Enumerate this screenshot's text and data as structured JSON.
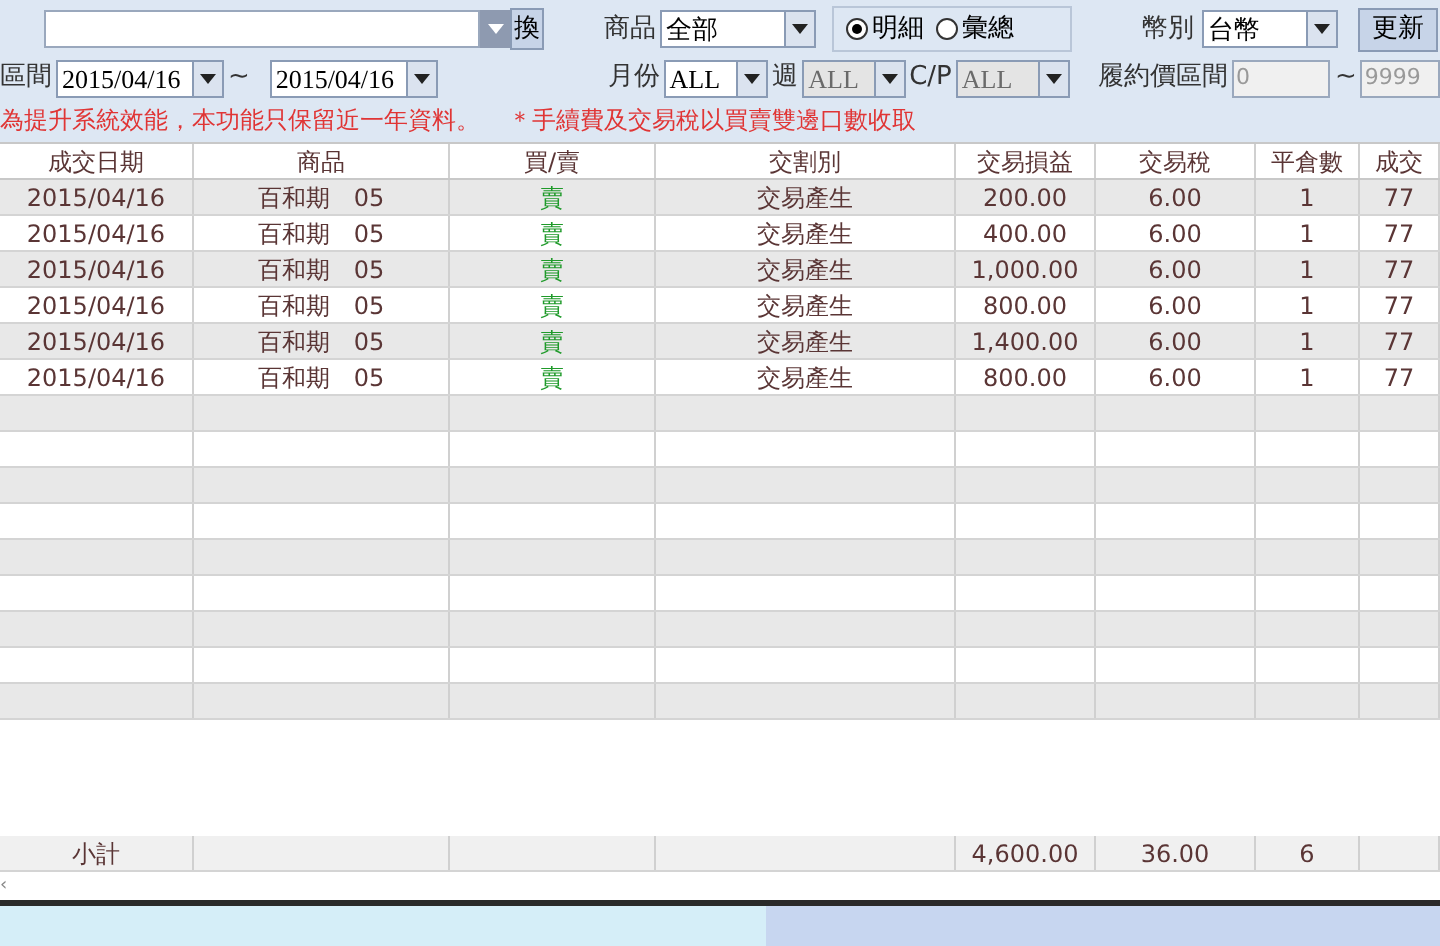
{
  "filters": {
    "account_button": "換",
    "product_label": "商品",
    "product_value": "全部",
    "view_options": [
      {
        "label": "明細",
        "selected": true
      },
      {
        "label": "彙總",
        "selected": false
      }
    ],
    "currency_label": "幣別",
    "currency_value": "台幣",
    "refresh_button": "更新",
    "date_label": "區間",
    "date_from": "2015/04/16",
    "date_sep": "~",
    "date_to": "2015/04/16",
    "month_label": "月份",
    "month_value": "ALL",
    "week_label": "週",
    "week_value": "ALL",
    "week_disabled": true,
    "cp_label": "C/P",
    "cp_value": "ALL",
    "cp_disabled": true,
    "strike_label": "履約價區間",
    "strike_from": "0",
    "strike_sep": "~",
    "strike_to": "9999",
    "strike_disabled": true
  },
  "notes": [
    "為提升系統效能，本功能只保留近一年資料。",
    "＊手續費及交易稅以買賣雙邊口數收取"
  ],
  "table": {
    "columns": [
      "成交日期",
      "商品",
      "買/賣",
      "交割別",
      "交易損益",
      "交易稅",
      "平倉數",
      "成交"
    ],
    "rows": [
      [
        "2015/04/16",
        "百和期　05",
        "賣",
        "交易產生",
        "200.00",
        "6.00",
        "1",
        "77"
      ],
      [
        "2015/04/16",
        "百和期　05",
        "賣",
        "交易產生",
        "400.00",
        "6.00",
        "1",
        "77"
      ],
      [
        "2015/04/16",
        "百和期　05",
        "賣",
        "交易產生",
        "1,000.00",
        "6.00",
        "1",
        "77"
      ],
      [
        "2015/04/16",
        "百和期　05",
        "賣",
        "交易產生",
        "800.00",
        "6.00",
        "1",
        "77"
      ],
      [
        "2015/04/16",
        "百和期　05",
        "賣",
        "交易產生",
        "1,400.00",
        "6.00",
        "1",
        "77"
      ],
      [
        "2015/04/16",
        "百和期　05",
        "賣",
        "交易產生",
        "800.00",
        "6.00",
        "1",
        "77"
      ]
    ],
    "subtotal": {
      "label": "小計",
      "profit": "4,600.00",
      "tax": "36.00",
      "closed": "6"
    }
  },
  "scroll_hint": "‹"
}
